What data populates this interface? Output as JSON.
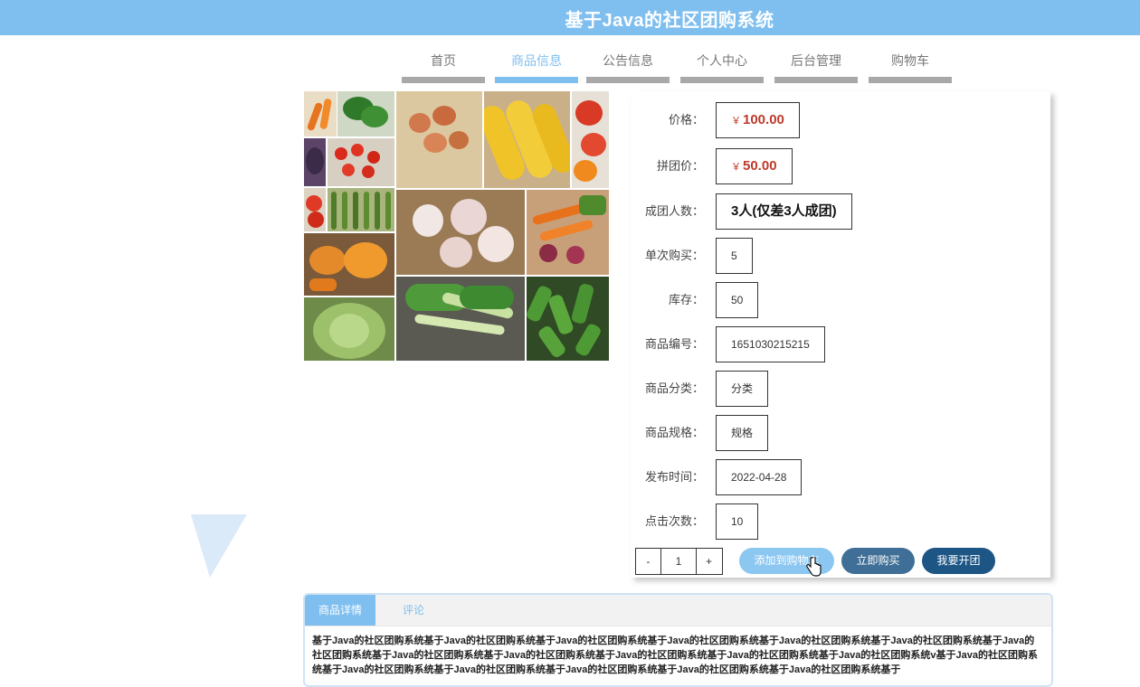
{
  "site": {
    "title": "基于Java的社区团购系统"
  },
  "nav": [
    {
      "label": "首页",
      "active": false
    },
    {
      "label": "商品信息",
      "active": true
    },
    {
      "label": "公告信息",
      "active": false
    },
    {
      "label": "个人中心",
      "active": false
    },
    {
      "label": "后台管理",
      "active": false
    },
    {
      "label": "购物车",
      "active": false
    }
  ],
  "product": {
    "currency": "￥",
    "fields": {
      "price": {
        "label": "价格：",
        "value": "100.00"
      },
      "group_price": {
        "label": "拼团价：",
        "value": "50.00"
      },
      "group_size": {
        "label": "成团人数：",
        "value": "3人(仅差3人成团)"
      },
      "per_purchase": {
        "label": "单次购买：",
        "value": "5"
      },
      "stock": {
        "label": "库存：",
        "value": "50"
      },
      "code": {
        "label": "商品编号：",
        "value": "1651030215215"
      },
      "category": {
        "label": "商品分类：",
        "value": "分类"
      },
      "spec": {
        "label": "商品规格：",
        "value": "规格"
      },
      "publish_time": {
        "label": "发布时间：",
        "value": "2022-04-28"
      },
      "clicks": {
        "label": "点击次数：",
        "value": "10"
      }
    }
  },
  "purchase": {
    "minus": "-",
    "quantity": "1",
    "plus": "+",
    "add_to_cart": "添加到购物车",
    "buy_now": "立即购买",
    "start_group": "我要开团"
  },
  "tabs": {
    "detail": "商品详情",
    "comments": "评论"
  },
  "detail_text": "基于Java的社区团购系统基于Java的社区团购系统基于Java的社区团购系统基于Java的社区团购系统基于Java的社区团购系统基于Java的社区团购系统基于Java的社区团购系统基于Java的社区团购系统基于Java的社区团购系统基于Java的社区团购系统基于Java的社区团购系统基于Java的社区团购系统v基于Java的社区团购系统基于Java的社区团购系统基于Java的社区团购系统基于Java的社区团购系统基于Java的社区团购系统基于Java的社区团购系统基于",
  "colors": {
    "accent": "#7fbfef",
    "price": "#c0392b",
    "buy": "#3f6f97",
    "group": "#1d5585"
  }
}
